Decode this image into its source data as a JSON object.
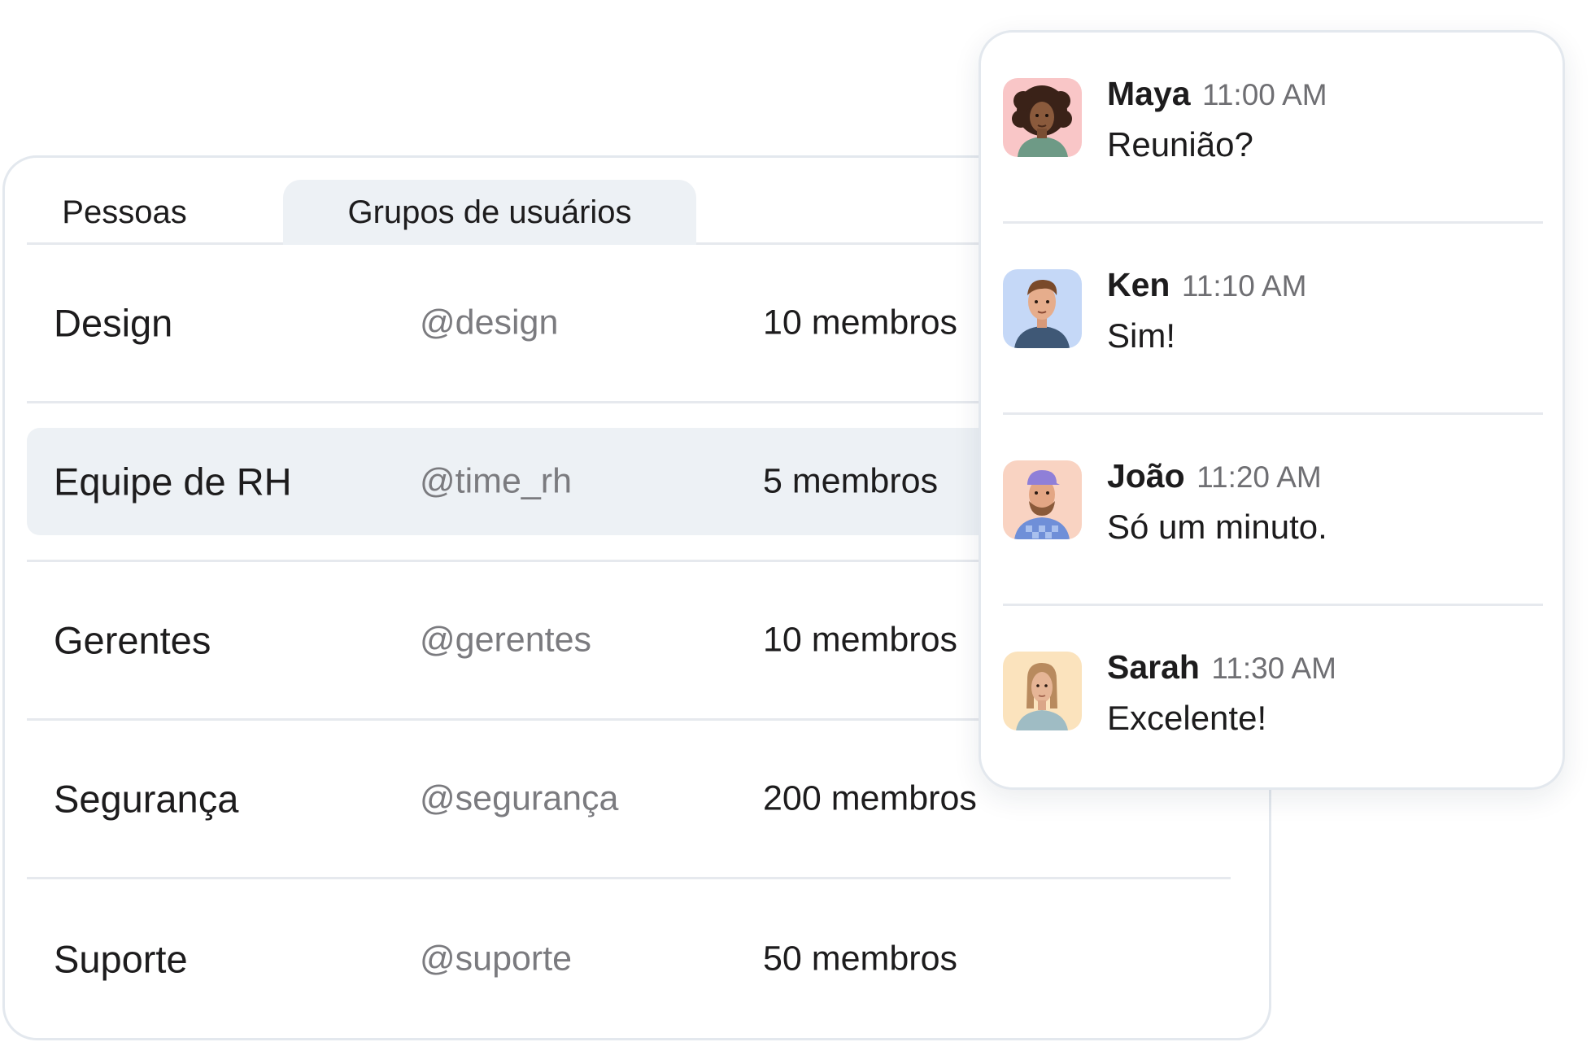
{
  "tabs": {
    "people": "Pessoas",
    "groups": "Grupos de usuários"
  },
  "groups": [
    {
      "name": "Design",
      "handle": "@design",
      "members": "10 membros"
    },
    {
      "name": "Equipe de RH",
      "handle": "@time_rh",
      "members": "5 membros"
    },
    {
      "name": "Gerentes",
      "handle": "@gerentes",
      "members": "10 membros"
    },
    {
      "name": "Segurança",
      "handle": "@segurança",
      "members": "200 membros"
    },
    {
      "name": "Suporte",
      "handle": "@suporte",
      "members": "50 membros"
    }
  ],
  "messages": [
    {
      "name": "Maya",
      "time": "11:00 AM",
      "text": "Reunião?",
      "avatar_bg": "#f9c6c7"
    },
    {
      "name": "Ken",
      "time": "11:10 AM",
      "text": "Sim!",
      "avatar_bg": "#c5d8f7"
    },
    {
      "name": "João",
      "time": "11:20 AM",
      "text": "Só um minuto.",
      "avatar_bg": "#f9d3c2"
    },
    {
      "name": "Sarah",
      "time": "11:30 AM",
      "text": "Excelente!",
      "avatar_bg": "#fbe3bd"
    }
  ],
  "colors": {
    "highlight": "#edf1f5",
    "border": "#e3e8ee",
    "muted_text": "#7b7b7f"
  }
}
